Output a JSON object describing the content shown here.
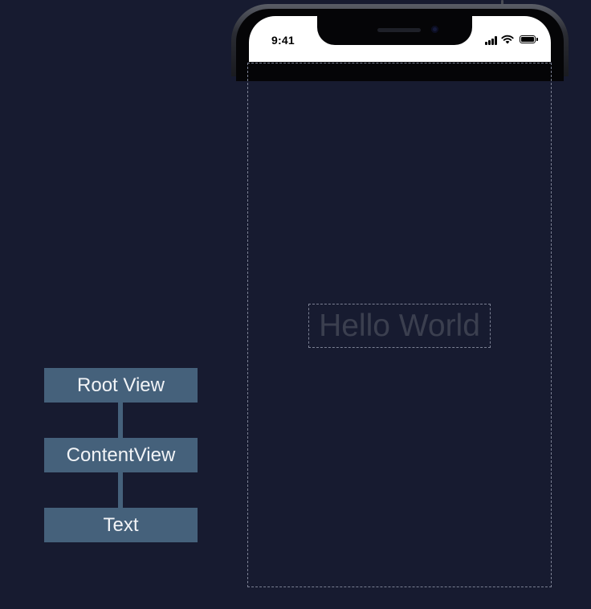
{
  "status_bar": {
    "time": "9:41"
  },
  "preview": {
    "hello_text": "Hello World"
  },
  "hierarchy": {
    "nodes": [
      "Root View",
      "ContentView",
      "Text"
    ]
  },
  "colors": {
    "background": "#171b30",
    "node_fill": "#45617b",
    "node_text": "#f2f4f7",
    "hello_text": "#3b3f4f",
    "dashed_border": "#7a7f92"
  }
}
